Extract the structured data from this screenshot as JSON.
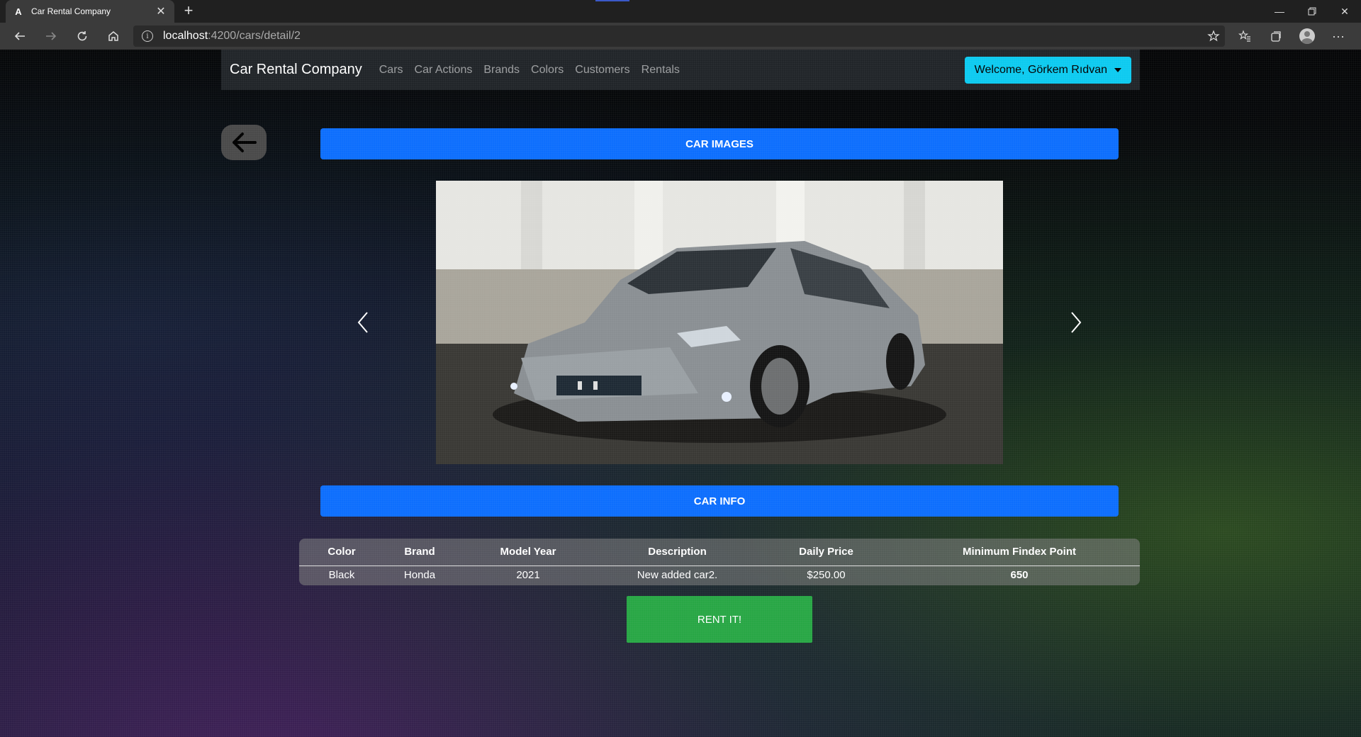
{
  "browser": {
    "tab_title": "Car Rental Company",
    "tab_favicon": "A",
    "url_host": "localhost",
    "url_path": ":4200/cars/detail/2"
  },
  "navbar": {
    "brand": "Car Rental Company",
    "links": [
      "Cars",
      "Car Actions",
      "Brands",
      "Colors",
      "Customers",
      "Rentals"
    ],
    "welcome": "Welcome, Görkem Rıdvan"
  },
  "images_section": {
    "title": "CAR IMAGES"
  },
  "info_section": {
    "title": "CAR INFO"
  },
  "car_table": {
    "headers": [
      "Color",
      "Brand",
      "Model Year",
      "Description",
      "Daily Price",
      "Minimum Findex Point"
    ],
    "row": [
      "Black",
      "Honda",
      "2021",
      "New added car2.",
      "$250.00",
      "650"
    ]
  },
  "rent_button": "RENT IT!",
  "colors": {
    "primary": "#0d6efd",
    "info": "#0dcaf0",
    "success": "#28a745",
    "navbar": "#212529"
  }
}
